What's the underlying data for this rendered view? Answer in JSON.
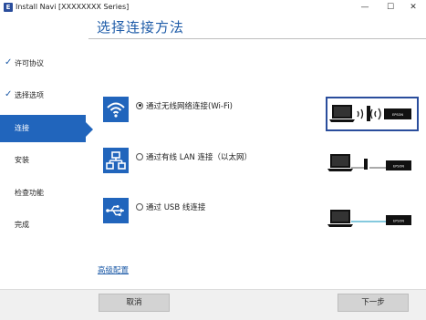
{
  "window": {
    "title": "Install Navi [XXXXXXXX Series]",
    "app_icon_letter": "E",
    "minimize": "—",
    "maximize": "☐",
    "close": "✕"
  },
  "header": {
    "title": "选择连接方法"
  },
  "sidebar": {
    "items": [
      {
        "label": "许可协议",
        "checked": true,
        "active": false
      },
      {
        "label": "选择选项",
        "checked": true,
        "active": false
      },
      {
        "label": "连接",
        "checked": false,
        "active": true
      },
      {
        "label": "安装",
        "checked": false,
        "active": false
      },
      {
        "label": "检查功能",
        "checked": false,
        "active": false
      },
      {
        "label": "完成",
        "checked": false,
        "active": false
      }
    ]
  },
  "options": [
    {
      "label": "通过无线网络连接(Wi-Fi)",
      "selected": true,
      "icon": "wifi-icon"
    },
    {
      "label": "通过有线 LAN 连接（以太网）",
      "selected": false,
      "icon": "ethernet-icon"
    },
    {
      "label": "通过 USB 线连接",
      "selected": false,
      "icon": "usb-icon"
    }
  ],
  "printer_label": "EPSON",
  "advanced_link": "高级配置",
  "footer": {
    "cancel_label": "取消",
    "next_label": "下一步"
  },
  "colors": {
    "accent": "#2165bc",
    "title": "#1f5ca8",
    "selection_frame": "#2a4d9c",
    "usb_cable": "#3aa9c9"
  }
}
